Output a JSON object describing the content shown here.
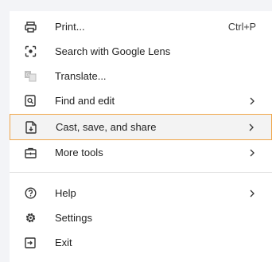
{
  "menu": {
    "items": [
      {
        "label": "Print...",
        "shortcut": "Ctrl+P",
        "icon": "printer-icon"
      },
      {
        "label": "Search with Google Lens",
        "icon": "google-lens-icon"
      },
      {
        "label": "Translate...",
        "icon": "translate-icon"
      },
      {
        "label": "Find and edit",
        "icon": "find-icon",
        "has_submenu": true
      },
      {
        "label": "Cast, save, and share",
        "icon": "cast-save-share-icon",
        "has_submenu": true,
        "highlighted": true
      },
      {
        "label": "More tools",
        "icon": "toolbox-icon",
        "has_submenu": true
      },
      {
        "label": "Help",
        "icon": "help-icon",
        "has_submenu": true
      },
      {
        "label": "Settings",
        "icon": "gear-icon"
      },
      {
        "label": "Exit",
        "icon": "exit-icon"
      }
    ]
  },
  "colors": {
    "highlight_border": "#f0a64a",
    "highlight_bg": "#f3f3f3"
  }
}
